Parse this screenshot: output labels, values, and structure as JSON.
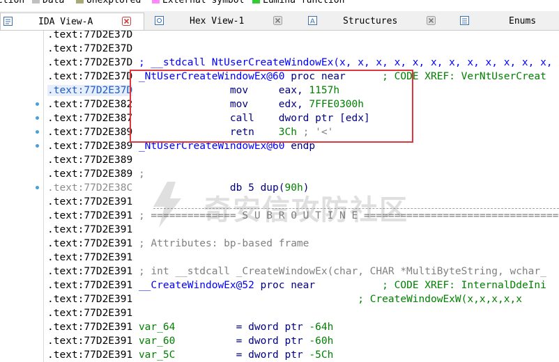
{
  "legend": {
    "items": [
      {
        "label": "ction",
        "color": ""
      },
      {
        "label": "Data",
        "color": "#c0c0c0"
      },
      {
        "label": "Unexplored",
        "color": "#a9a978"
      },
      {
        "label": "External symbol",
        "color": "#ff86ff"
      },
      {
        "label": "Lumina function",
        "color": "#33cc33"
      }
    ]
  },
  "tabs": [
    {
      "label": "IDA View-A",
      "icon": "ida-view-icon",
      "active": true
    },
    {
      "label": "Hex View-1",
      "icon": "hex-view-icon",
      "active": false
    },
    {
      "label": "Structures",
      "icon": "structures-icon",
      "active": false
    },
    {
      "label": "Enums",
      "icon": "enums-icon",
      "active": false
    }
  ],
  "code": {
    "lines": [
      {
        "addr": ".text:77D2E37D",
        "rest": ""
      },
      {
        "addr": ".text:77D2E37D",
        "rest": ""
      },
      {
        "addr": ".text:77D2E37D",
        "rest": " ; __stdcall NtUserCreateWindowEx(x, x, x, x, x, x, x, x, x, x, x, x, x"
      },
      {
        "addr": ".text:77D2E37D",
        "name": "_NtUserCreateWindowEx@60",
        "rest": " proc near",
        "xref": "; CODE XREF: VerNtUserCreat"
      },
      {
        "addr": ".text:77D2E37D",
        "mnem": "mov",
        "op1": "eax, ",
        "num": "1157h"
      },
      {
        "addr": ".text:77D2E382",
        "mnem": "mov",
        "op1": "edx, ",
        "num": "7FFE0300h"
      },
      {
        "addr": ".text:77D2E387",
        "mnem": "call",
        "op1": "dword ptr [edx]",
        "num": ""
      },
      {
        "addr": ".text:77D2E389",
        "mnem": "retn",
        "op1": "",
        "num": "3Ch",
        "cmt": " ; '<'"
      },
      {
        "addr": ".text:77D2E389",
        "name": "_NtUserCreateWindowEx@60",
        "rest": " endp"
      },
      {
        "addr": ".text:77D2E389",
        "rest": ""
      },
      {
        "addr": ".text:77D2E389",
        "rest": " ;"
      },
      {
        "addr": ".text:77D2E38C",
        "mnem": "db",
        "op1": "5 dup(",
        "num": "90h",
        "tail": ")"
      },
      {
        "addr": ".text:77D2E391",
        "rest": ""
      },
      {
        "addr": ".text:77D2E391",
        "rest": " ; ============== S U B R O U T I N E ======================================="
      },
      {
        "addr": ".text:77D2E391",
        "rest": ""
      },
      {
        "addr": ".text:77D2E391",
        "rest": " ; Attributes: bp-based frame"
      },
      {
        "addr": ".text:77D2E391",
        "rest": ""
      },
      {
        "addr": ".text:77D2E391",
        "rest": " ; int __stdcall _CreateWindowEx(char, CHAR *MultiByteString, wchar_"
      },
      {
        "addr": ".text:77D2E391",
        "name": "__CreateWindowEx@52",
        "rest": " proc near",
        "xref": "; CODE XREF: InternalDdeIni"
      },
      {
        "addr": ".text:77D2E391",
        "xref": "; CreateWindowExW(x,x,x,x,x"
      },
      {
        "addr": ".text:77D2E391",
        "rest": ""
      },
      {
        "addr": ".text:77D2E391",
        "var": "var_64",
        "eq": "= dword ptr ",
        "num": "-64h"
      },
      {
        "addr": ".text:77D2E391",
        "var": "var_60",
        "eq": "= dword ptr ",
        "num": "-60h"
      },
      {
        "addr": ".text:77D2E391",
        "var": "var_5C",
        "eq": "= dword ptr ",
        "num": "-5Ch"
      }
    ]
  },
  "watermark": {
    "text": "奇安信攻防社区"
  },
  "colors": {
    "highlight_box": "#e0353b",
    "name": "#0000ff",
    "number": "#008000",
    "comment": "#808080"
  }
}
